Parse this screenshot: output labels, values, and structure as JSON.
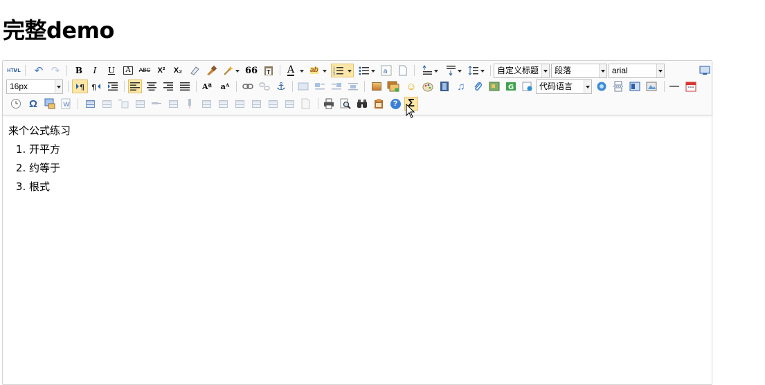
{
  "page": {
    "title": "完整demo"
  },
  "toolbar": {
    "row1": {
      "html_label": "HTML",
      "bold": "B",
      "italic": "I",
      "underline": "U",
      "border": "A",
      "strike": "ABC",
      "sup": "X²",
      "sub": "X₂",
      "quote": "66",
      "fontcolor": "A",
      "highlight": "ab",
      "customstyle_value": "自定义标题",
      "paragraph_value": "段落",
      "fontfamily_value": "arial"
    },
    "row2": {
      "fontsize_value": "16px",
      "code_language_value": "代码语言"
    },
    "row3": {
      "omega": "Ω",
      "formula": "Σ",
      "help": "?"
    }
  },
  "content": {
    "intro": "来个公式练习",
    "items": [
      "开平方",
      "约等于",
      "根式"
    ]
  }
}
